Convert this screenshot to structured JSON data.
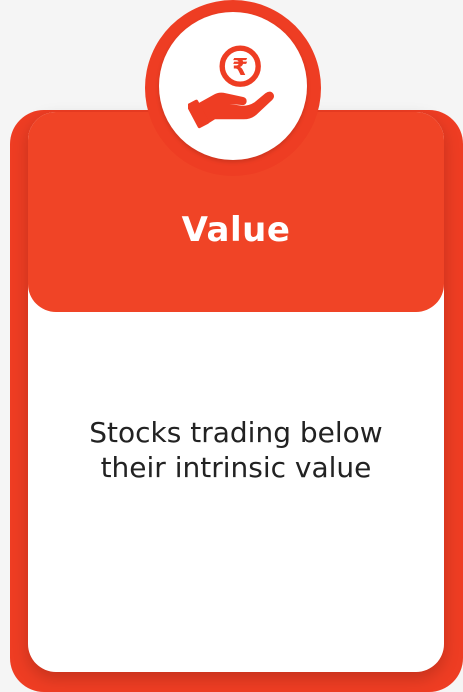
{
  "card": {
    "title": "Value",
    "description": "Stocks trading below their intrinsic value",
    "icon": "hand-rupee-icon",
    "rupee_symbol": "₹"
  },
  "colors": {
    "accent": "#f04426",
    "accent_dark": "#ee3d23",
    "background": "#f5f5f5",
    "card": "#ffffff",
    "text": "#222222"
  }
}
